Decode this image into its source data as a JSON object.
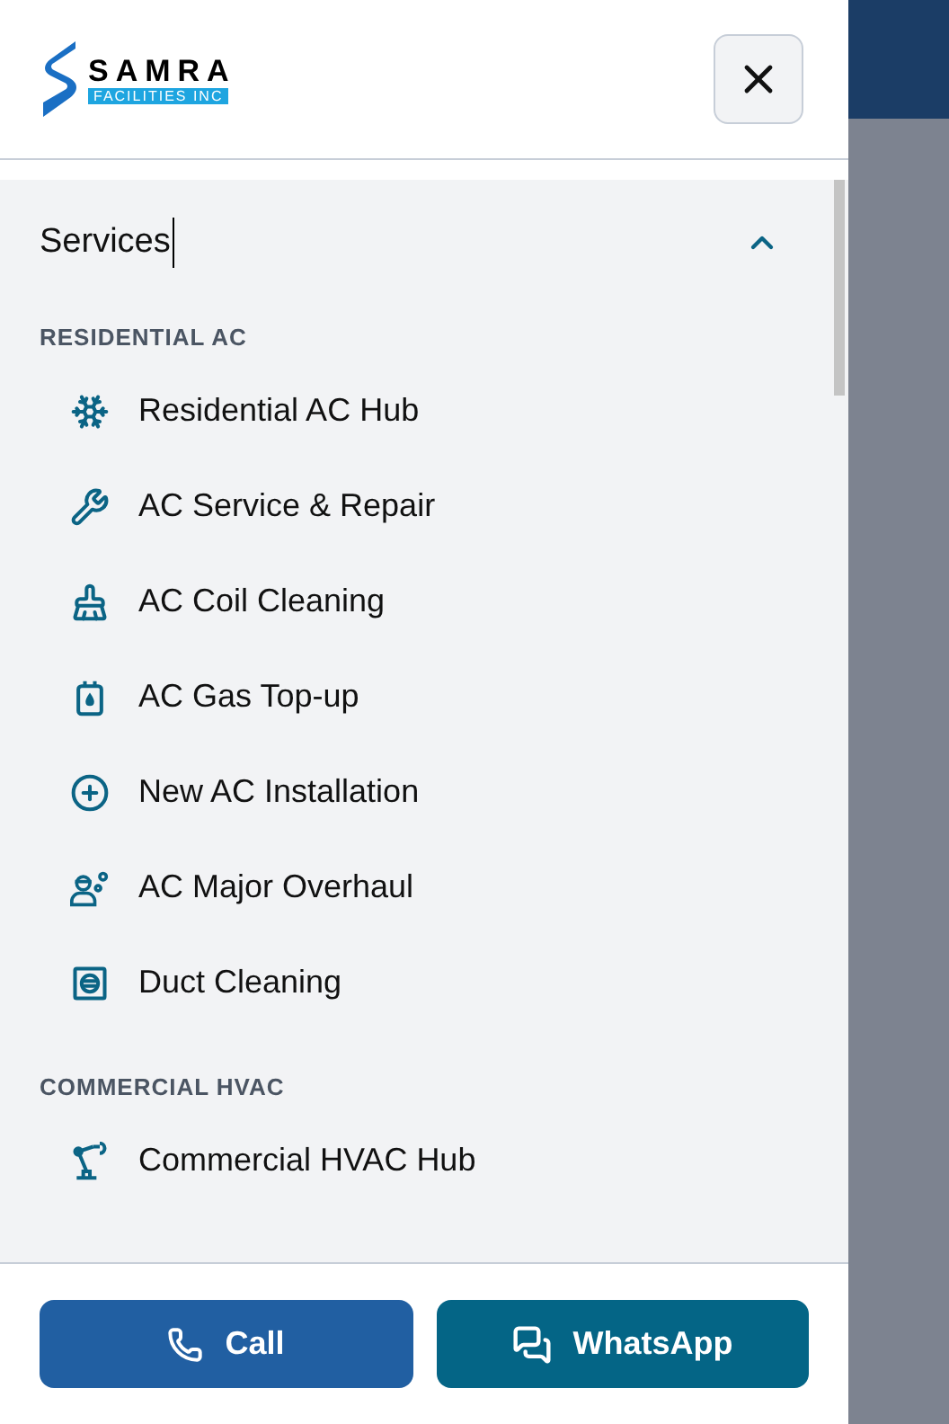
{
  "logo": {
    "name": "SAMRA",
    "tagline": "FACILITIES INC"
  },
  "menu": {
    "title": "Services",
    "expanded": true,
    "sections": [
      {
        "heading": "RESIDENTIAL AC",
        "items": [
          {
            "label": "Residential AC Hub",
            "kind": "snowflake"
          },
          {
            "label": "AC Service & Repair",
            "kind": "wrench"
          },
          {
            "label": "AC Coil Cleaning",
            "kind": "brush"
          },
          {
            "label": "AC Gas Top-up",
            "kind": "canister"
          },
          {
            "label": "New AC Installation",
            "kind": "plus"
          },
          {
            "label": "AC Major Overhaul",
            "kind": "worker"
          },
          {
            "label": "Duct Cleaning",
            "kind": "duct"
          }
        ]
      },
      {
        "heading": "COMMERCIAL HVAC",
        "items": [
          {
            "label": "Commercial HVAC Hub",
            "kind": "robot"
          }
        ]
      }
    ]
  },
  "buttons": [
    {
      "label": "Call",
      "kind": "call"
    },
    {
      "label": "WhatsApp",
      "kind": "whatsapp"
    }
  ]
}
